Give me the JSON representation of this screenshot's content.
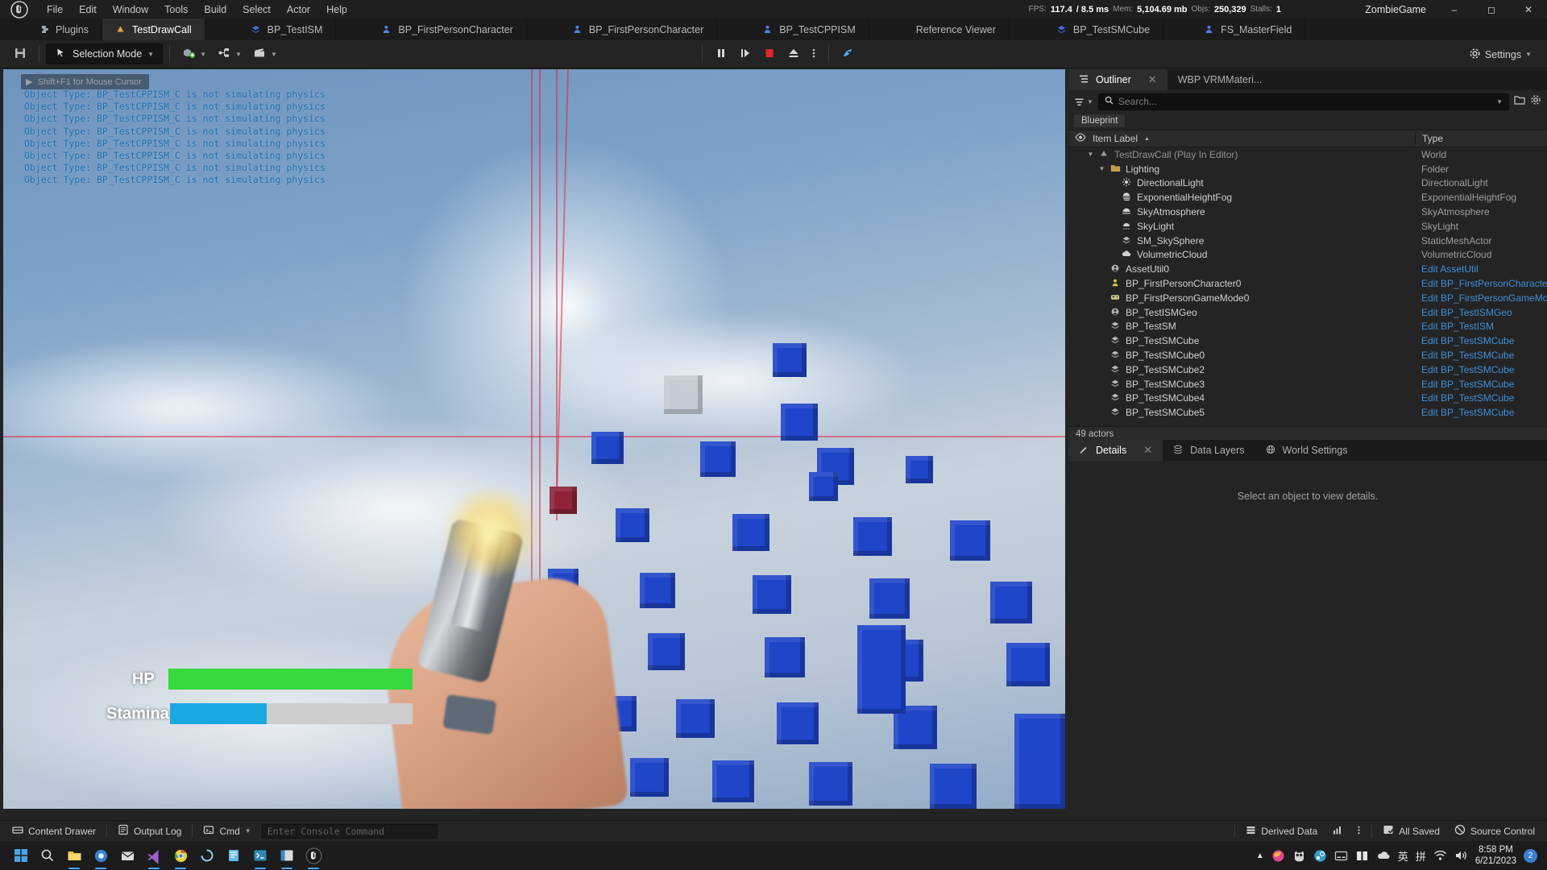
{
  "menu": {
    "logo_icon": "unreal-engine-logo",
    "items": [
      "File",
      "Edit",
      "Window",
      "Tools",
      "Build",
      "Select",
      "Actor",
      "Help"
    ]
  },
  "stats": {
    "fps_label": "FPS:",
    "fps_value": "117.4",
    "frametime": "/ 8.5 ms",
    "mem_label": "Mem:",
    "mem_value": "5,104.69 mb",
    "objs_label": "Objs:",
    "objs_value": "250,329",
    "stalls_label": "Stalls:",
    "stalls_value": "1"
  },
  "window": {
    "title": "ZombieGame",
    "minimize_icon": "minimize-icon",
    "maximize_icon": "maximize-icon",
    "close_icon": "close-icon"
  },
  "tabs": [
    {
      "label": "Plugins",
      "icon": "plugin-icon",
      "active": false
    },
    {
      "label": "TestDrawCall",
      "icon": "level-icon",
      "active": true
    },
    {
      "label": "BP_TestISM",
      "icon": "blueprint-icon",
      "active": false
    },
    {
      "label": "BP_FirstPersonCharacter",
      "icon": "character-icon",
      "active": false
    },
    {
      "label": "BP_FirstPersonCharacter",
      "icon": "character-icon",
      "active": false
    },
    {
      "label": "BP_TestCPPISM",
      "icon": "character-icon",
      "active": false
    },
    {
      "label": "Reference Viewer",
      "icon": "none",
      "active": false
    },
    {
      "label": "BP_TestSMCube",
      "icon": "blueprint-icon",
      "active": false
    },
    {
      "label": "FS_MasterField",
      "icon": "character-icon",
      "active": false
    }
  ],
  "toolbar": {
    "save_icon": "save-icon",
    "mode_label": "Selection Mode",
    "mode_icon": "cursor-icon",
    "add_icon": "add-actor-icon",
    "blueprint_icon": "blueprints-icon",
    "cinematics_icon": "cinematics-icon",
    "pause_icon": "pause-icon",
    "step_icon": "frame-step-icon",
    "stop_icon": "stop-icon",
    "eject_icon": "eject-icon",
    "more_icon": "more-options-icon",
    "platforms_icon": "platforms-icon",
    "settings_label": "Settings",
    "settings_icon": "gear-icon"
  },
  "viewport": {
    "hint": "Shift+F1 for Mouse Cursor",
    "hint_icon": "play-triangle-icon",
    "debug_line": "Object Type: BP_TestCPPISM_C is not simulating physics",
    "debug_line_count": 8,
    "debug_color": "#1b6fb0",
    "hud": {
      "hp_label": "HP",
      "hp_percent": 100,
      "hp_color": "#37d93d",
      "stamina_label": "Stamina",
      "stamina_percent": 40,
      "stamina_color": "#19a8e0",
      "track_color": "#cdcdcd"
    }
  },
  "outliner": {
    "tabs": [
      {
        "label": "Outliner",
        "icon": "outliner-icon",
        "active": true,
        "close_icon": "close-icon"
      },
      {
        "label": "WBP VRMMateri...",
        "icon": "widget-icon",
        "active": false
      }
    ],
    "filter_icon": "filter-icon",
    "filter_caret_icon": "chevron-down-icon",
    "search_icon": "search-icon",
    "search_value": "",
    "search_placeholder": "Search...",
    "search_caret_icon": "chevron-down-icon",
    "save_icon": "save-folder-icon",
    "settings_icon": "gear-icon",
    "filter_chip": "Blueprint",
    "col_eye_icon": "eye-icon",
    "col_item_label": "Item Label",
    "col_sort_icon": "sort-ascending-icon",
    "col_type_label": "Type",
    "rows": [
      {
        "label": "TestDrawCall (Play In Editor)",
        "type": "World",
        "indent": 1,
        "disclosure": "down",
        "icon": "level-icon",
        "dim": true,
        "link": false
      },
      {
        "label": "Lighting",
        "type": "Folder",
        "indent": 2,
        "disclosure": "down",
        "icon": "folder-icon",
        "dim": false,
        "link": false
      },
      {
        "label": "DirectionalLight",
        "type": "DirectionalLight",
        "indent": 3,
        "disclosure": "",
        "icon": "directional-light-icon",
        "dim": false,
        "link": false
      },
      {
        "label": "ExponentialHeightFog",
        "type": "ExponentialHeightFog",
        "indent": 3,
        "disclosure": "",
        "icon": "fog-icon",
        "dim": false,
        "link": false
      },
      {
        "label": "SkyAtmosphere",
        "type": "SkyAtmosphere",
        "indent": 3,
        "disclosure": "",
        "icon": "sky-atmosphere-icon",
        "dim": false,
        "link": false
      },
      {
        "label": "SkyLight",
        "type": "SkyLight",
        "indent": 3,
        "disclosure": "",
        "icon": "sky-light-icon",
        "dim": false,
        "link": false
      },
      {
        "label": "SM_SkySphere",
        "type": "StaticMeshActor",
        "indent": 3,
        "disclosure": "",
        "icon": "static-mesh-icon",
        "dim": false,
        "link": false
      },
      {
        "label": "VolumetricCloud",
        "type": "VolumetricCloud",
        "indent": 3,
        "disclosure": "",
        "icon": "cloud-icon",
        "dim": false,
        "link": false
      },
      {
        "label": "AssetUtil0",
        "type": "Edit AssetUtil",
        "indent": 2,
        "disclosure": "",
        "icon": "actor-icon",
        "dim": false,
        "link": true
      },
      {
        "label": "BP_FirstPersonCharacter0",
        "type": "Edit BP_FirstPersonCharacte",
        "indent": 2,
        "disclosure": "",
        "icon": "character-icon",
        "dim": false,
        "link": true
      },
      {
        "label": "BP_FirstPersonGameMode0",
        "type": "Edit BP_FirstPersonGameMo",
        "indent": 2,
        "disclosure": "",
        "icon": "gamemode-icon",
        "dim": false,
        "link": true
      },
      {
        "label": "BP_TestISMGeo",
        "type": "Edit BP_TestISMGeo",
        "indent": 2,
        "disclosure": "",
        "icon": "actor-icon",
        "dim": false,
        "link": true
      },
      {
        "label": "BP_TestSM",
        "type": "Edit BP_TestISM",
        "indent": 2,
        "disclosure": "",
        "icon": "static-mesh-icon",
        "dim": false,
        "link": true
      },
      {
        "label": "BP_TestSMCube",
        "type": "Edit BP_TestSMCube",
        "indent": 2,
        "disclosure": "",
        "icon": "static-mesh-icon",
        "dim": false,
        "link": true
      },
      {
        "label": "BP_TestSMCube0",
        "type": "Edit BP_TestSMCube",
        "indent": 2,
        "disclosure": "",
        "icon": "static-mesh-icon",
        "dim": false,
        "link": true
      },
      {
        "label": "BP_TestSMCube2",
        "type": "Edit BP_TestSMCube",
        "indent": 2,
        "disclosure": "",
        "icon": "static-mesh-icon",
        "dim": false,
        "link": true
      },
      {
        "label": "BP_TestSMCube3",
        "type": "Edit BP_TestSMCube",
        "indent": 2,
        "disclosure": "",
        "icon": "static-mesh-icon",
        "dim": false,
        "link": true
      },
      {
        "label": "BP_TestSMCube4",
        "type": "Edit BP_TestSMCube",
        "indent": 2,
        "disclosure": "",
        "icon": "static-mesh-icon",
        "dim": false,
        "link": true
      },
      {
        "label": "BP_TestSMCube5",
        "type": "Edit BP_TestSMCube",
        "indent": 2,
        "disclosure": "",
        "icon": "static-mesh-icon",
        "dim": false,
        "link": true
      }
    ],
    "actor_count": "49 actors"
  },
  "details": {
    "tabs": [
      {
        "label": "Details",
        "icon": "details-icon",
        "active": true,
        "close_icon": "close-icon"
      },
      {
        "label": "Data Layers",
        "icon": "data-layers-icon",
        "active": false
      },
      {
        "label": "World Settings",
        "icon": "world-settings-icon",
        "active": false
      }
    ],
    "empty_message": "Select an object to view details."
  },
  "statusbar": {
    "content_drawer": "Content Drawer",
    "content_drawer_icon": "drawer-icon",
    "output_log": "Output Log",
    "output_log_icon": "log-icon",
    "cmd_label": "Cmd",
    "cmd_icon": "console-icon",
    "cmd_caret_icon": "chevron-down-icon",
    "console_value": "",
    "console_placeholder": "Enter Console Command",
    "derived_data": "Derived Data",
    "derived_data_icon": "database-icon",
    "stats_icon": "stats-icon",
    "more_icon": "more-vertical-icon",
    "all_saved": "All Saved",
    "all_saved_icon": "saved-icon",
    "source_control": "Source Control",
    "source_control_icon": "source-control-off-icon"
  },
  "taskbar": {
    "items": [
      {
        "icon": "start-icon",
        "name": "start-button",
        "running": false
      },
      {
        "icon": "search-icon",
        "name": "taskbar-search",
        "running": false
      },
      {
        "icon": "folder-icon",
        "name": "file-explorer",
        "running": true
      },
      {
        "icon": "browser-icon",
        "name": "browser",
        "running": true
      },
      {
        "icon": "mail-icon",
        "name": "mail",
        "running": false
      },
      {
        "icon": "code-icon",
        "name": "visual-studio-code",
        "running": true
      },
      {
        "icon": "chrome-icon",
        "name": "chrome",
        "running": true
      },
      {
        "icon": "loading-icon",
        "name": "loading-app",
        "running": false
      },
      {
        "icon": "book-icon",
        "name": "notes-app",
        "running": false
      },
      {
        "icon": "terminal-icon",
        "name": "terminal",
        "running": true
      },
      {
        "icon": "window-icon",
        "name": "window-app",
        "running": true
      },
      {
        "icon": "unreal-icon",
        "name": "unreal-editor",
        "running": true
      }
    ],
    "tray": {
      "expand_icon": "chevron-up-icon",
      "icons": [
        "firefox-icon",
        "owl-icon",
        "steam-icon",
        "subtitle-icon",
        "windows-icon",
        "onedrive-icon"
      ],
      "ime_lang": "英",
      "ime_pinyin": "拼",
      "network_icon": "wifi-icon",
      "volume_icon": "speaker-icon",
      "time": "8:58 PM",
      "date": "6/21/2023",
      "notification_count": "2"
    }
  }
}
